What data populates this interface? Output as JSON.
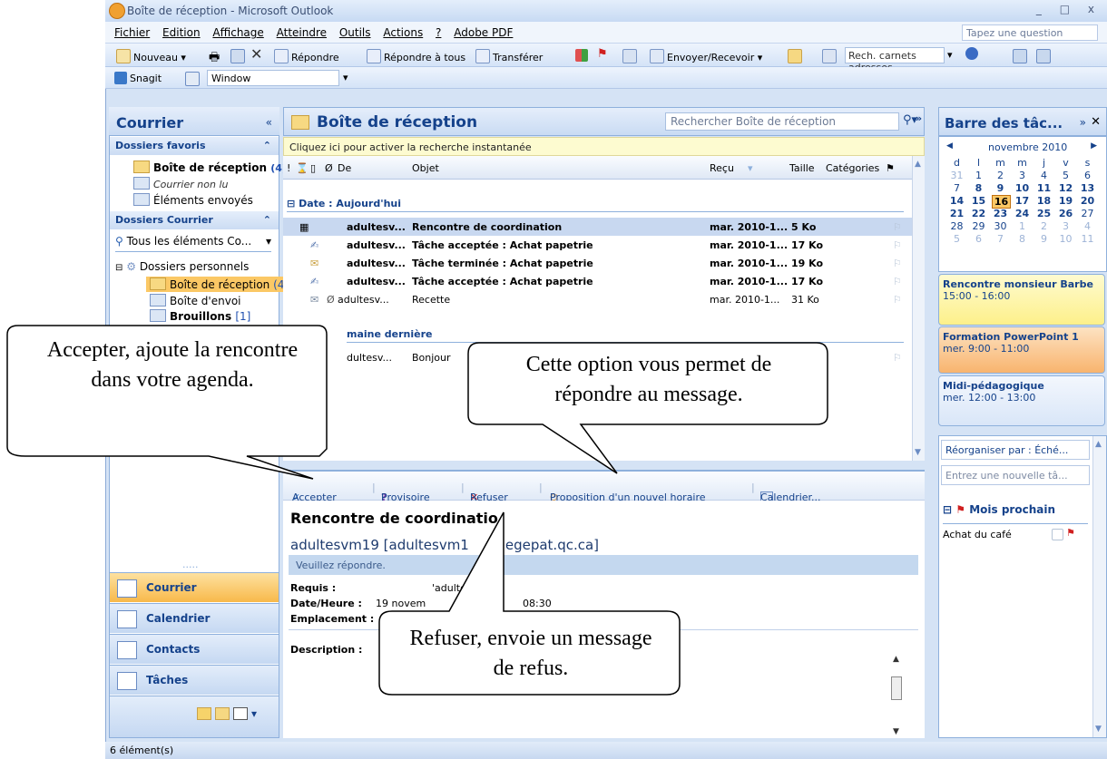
{
  "window": {
    "title": "Boîte de réception - Microsoft Outlook",
    "controls": "_ □ x"
  },
  "menu": {
    "items": [
      "Fichier",
      "Edition",
      "Affichage",
      "Atteindre",
      "Outils",
      "Actions",
      "?",
      "Adobe PDF"
    ],
    "ask_placeholder": "Tapez une question"
  },
  "toolbar": {
    "new": "Nouveau",
    "reply": "Répondre",
    "reply_all": "Répondre à tous",
    "forward": "Transférer",
    "send_receive": "Envoyer/Recevoir",
    "search_contacts": "Rech. carnets adresses"
  },
  "toolbar2": {
    "snagit": "Snagit",
    "window": "Window"
  },
  "nav": {
    "title": "Courrier",
    "favorites_header": "Dossiers favoris",
    "favorites": [
      {
        "label": "Boîte de réception",
        "count": "(4)"
      },
      {
        "label": "Courrier non lu"
      },
      {
        "label": "Éléments envoyés"
      }
    ],
    "mail_folders_header": "Dossiers Courrier",
    "all_items": "Tous les éléments Co...",
    "personal_folders": "Dossiers personnels",
    "folders": [
      {
        "label": "Boîte de réception",
        "count": "(4"
      },
      {
        "label": "Boîte d'envoi"
      },
      {
        "label": "Brouillons",
        "count": "[1]"
      }
    ],
    "buttons": [
      "Courrier",
      "Calendrier",
      "Contacts",
      "Tâches"
    ]
  },
  "inbox": {
    "title": "Boîte de réception",
    "search_placeholder": "Rechercher Boîte de réception",
    "instant_search": "Cliquez ici pour activer la recherche instantanée",
    "columns": {
      "from": "De",
      "subject": "Objet",
      "received": "Reçu",
      "size": "Taille",
      "categories": "Catégories"
    },
    "group_today": "Date : Aujourd'hui",
    "group_last_week": "maine dernière",
    "messages_today": [
      {
        "from": "adultesv...",
        "subject": "Rencontre de coordination",
        "received": "mar. 2010-1...",
        "size": "5 Ko"
      },
      {
        "from": "adultesv...",
        "subject": "Tâche acceptée : Achat papetrie",
        "received": "mar. 2010-1...",
        "size": "17 Ko"
      },
      {
        "from": "adultesv...",
        "subject": "Tâche terminée : Achat papetrie",
        "received": "mar. 2010-1...",
        "size": "19 Ko"
      },
      {
        "from": "adultesv...",
        "subject": "Tâche acceptée : Achat papetrie",
        "received": "mar. 2010-1...",
        "size": "17 Ko"
      },
      {
        "from": "adultesv...",
        "subject": "Recette",
        "received": "mar. 2010-1...",
        "size": "31 Ko"
      }
    ],
    "messages_last_week": [
      {
        "from": "dultesv...",
        "subject": "Bonjour"
      }
    ]
  },
  "reading": {
    "actions": {
      "accept": "Accepter",
      "tentative": "Provisoire",
      "decline": "Refuser",
      "propose": "Proposition d'un nouvel horaire",
      "calendar": "Calendrier..."
    },
    "subject": "Rencontre de coordinatio",
    "from_start": "adultesvm19 [adultesvm1",
    "from_end": "egepat.qc.ca]",
    "reply_notice": "Veuillez répondre.",
    "labels": {
      "required": "Requis :",
      "datetime": "Date/Heure :",
      "location": "Emplacement :",
      "description": "Description :"
    },
    "required_value": "'adultesvm17",
    "datetime_value": "19 novem",
    "datetime_tail": "08:30"
  },
  "todo": {
    "title": "Barre des tâc...",
    "month": "novembre 2010",
    "weekdays": [
      "d",
      "l",
      "m",
      "m",
      "j",
      "v",
      "s"
    ],
    "weeks": [
      [
        "31",
        "1",
        "2",
        "3",
        "4",
        "5",
        "6"
      ],
      [
        "7",
        "8",
        "9",
        "10",
        "11",
        "12",
        "13"
      ],
      [
        "14",
        "15",
        "16",
        "17",
        "18",
        "19",
        "20"
      ],
      [
        "21",
        "22",
        "23",
        "24",
        "25",
        "26",
        "27"
      ],
      [
        "28",
        "29",
        "30",
        "1",
        "2",
        "3",
        "4"
      ],
      [
        "5",
        "6",
        "7",
        "8",
        "9",
        "10",
        "11"
      ]
    ],
    "appointments": [
      {
        "title": "Rencontre monsieur Barbe",
        "time": "15:00 - 16:00"
      },
      {
        "title": "Formation PowerPoint 1",
        "time": "mer. 9:00 - 11:00"
      },
      {
        "title": "Midi-pédagogique",
        "time": "mer. 12:00 - 13:00"
      }
    ],
    "arrange_by": "Réorganiser par : Éché...",
    "new_task_placeholder": "Entrez une nouvelle tâ...",
    "group": "Mois prochain",
    "tasks": [
      "Achat du café"
    ]
  },
  "status": {
    "count": "6 élément(s)"
  },
  "callouts": {
    "accept": "Accepter, ajoute la rencontre dans votre agenda.",
    "reply": "Cette option vous permet de répondre au message.",
    "decline": "Refuser, envoie un message de refus."
  },
  "colors": {
    "accent": "#15428b",
    "selected_nav": "#fbc865",
    "appt_yellow": "#fdf59a",
    "appt_orange": "#f9b97a",
    "appt_blue": "#d9e6f8"
  }
}
